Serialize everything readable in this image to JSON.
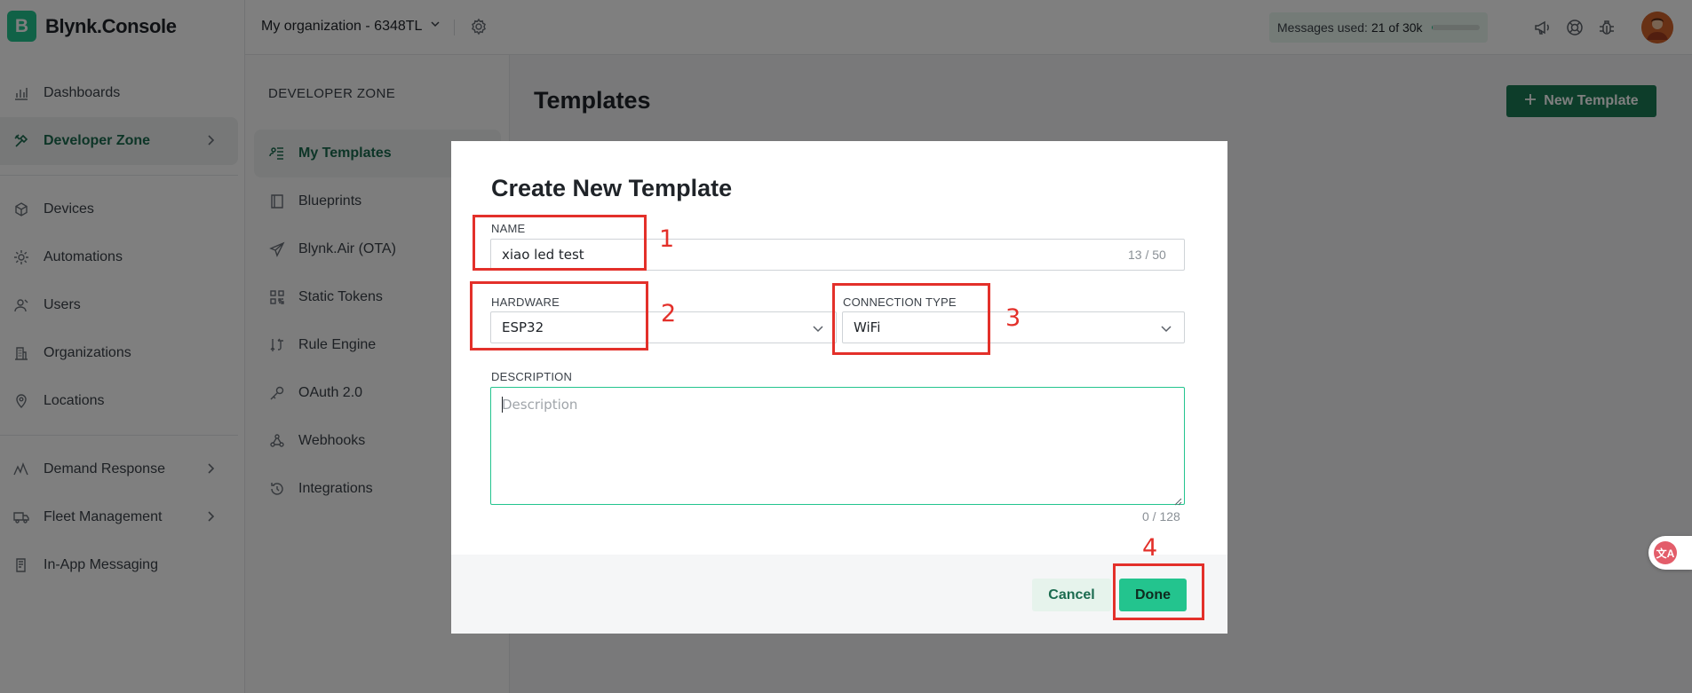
{
  "app": {
    "brand_letter": "B",
    "brand_name": "Blynk.Console"
  },
  "sidebar": {
    "items": [
      {
        "label": "Dashboards",
        "icon": "bar-chart-icon"
      },
      {
        "label": "Developer Zone",
        "icon": "tools-icon",
        "active": true,
        "chevron": true
      },
      {
        "label": "Devices",
        "icon": "cube-icon"
      },
      {
        "label": "Automations",
        "icon": "sun-gear-icon"
      },
      {
        "label": "Users",
        "icon": "users-icon"
      },
      {
        "label": "Organizations",
        "icon": "building-icon"
      },
      {
        "label": "Locations",
        "icon": "map-pin-icon"
      },
      {
        "label": "Demand Response",
        "icon": "pulse-icon",
        "chevron": true
      },
      {
        "label": "Fleet Management",
        "icon": "truck-icon",
        "chevron": true
      },
      {
        "label": "In-App Messaging",
        "icon": "message-icon"
      }
    ]
  },
  "header": {
    "org_name": "My organization - 6348TL",
    "usage_label": "Messages used:",
    "usage_value": "21 of 30k",
    "usage_fraction": 0.0007
  },
  "subnav": {
    "title": "DEVELOPER ZONE",
    "items": [
      {
        "label": "My Templates",
        "icon": "templates-icon",
        "active": true
      },
      {
        "label": "Blueprints",
        "icon": "book-icon"
      },
      {
        "label": "Blynk.Air (OTA)",
        "icon": "paper-plane-icon"
      },
      {
        "label": "Static Tokens",
        "icon": "qr-code-icon"
      },
      {
        "label": "Rule Engine",
        "icon": "rule-engine-icon"
      },
      {
        "label": "OAuth 2.0",
        "icon": "key-icon"
      },
      {
        "label": "Webhooks",
        "icon": "webhook-icon"
      },
      {
        "label": "Integrations",
        "icon": "integrations-icon"
      }
    ]
  },
  "main": {
    "title": "Templates",
    "new_button": "New Template"
  },
  "dialog": {
    "title": "Create New Template",
    "name": {
      "label": "NAME",
      "value": "xiao led test",
      "counter": "13 / 50"
    },
    "hardware": {
      "label": "HARDWARE",
      "value": "ESP32"
    },
    "connection": {
      "label": "CONNECTION TYPE",
      "value": "WiFi"
    },
    "description": {
      "label": "DESCRIPTION",
      "placeholder": "Description",
      "counter": "0 / 128"
    },
    "cancel": "Cancel",
    "done": "Done"
  },
  "annotations": [
    "1",
    "2",
    "3",
    "4"
  ],
  "widget": {
    "glyph": "文A"
  },
  "colors": {
    "brand": "#23c48e",
    "accent_dark": "#1b7a55",
    "annotation": "#e3302a"
  }
}
